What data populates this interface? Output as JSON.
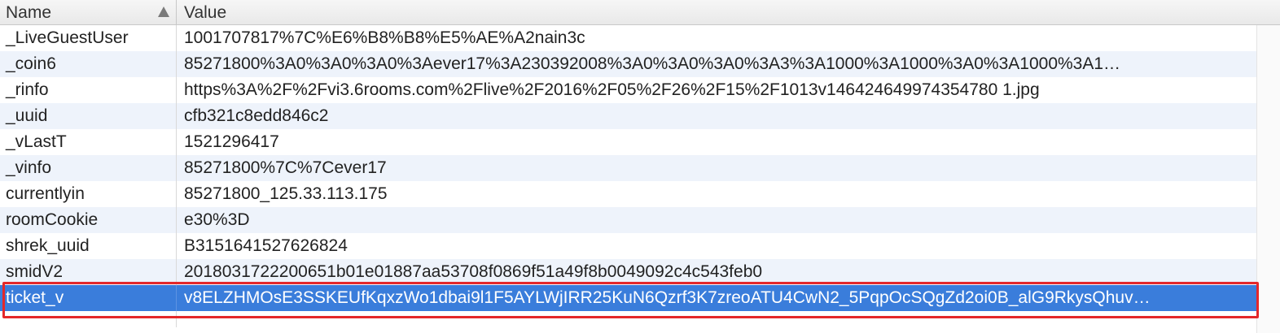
{
  "columns": {
    "name": "Name",
    "value": "Value"
  },
  "rows": [
    {
      "name": "_LiveGuestUser",
      "value": "1001707817%7C%E6%B8%B8%E5%AE%A2nain3c"
    },
    {
      "name": "_coin6",
      "value": "85271800%3A0%3A0%3A0%3Aever17%3A230392008%3A0%3A0%3A0%3A3%3A1000%3A1000%3A0%3A1000%3A1…"
    },
    {
      "name": "_rinfo",
      "value": "https%3A%2F%2Fvi3.6rooms.com%2Flive%2F2016%2F05%2F26%2F15%2F1013v146424649974354780 1.jpg"
    },
    {
      "name": "_uuid",
      "value": "cfb321c8edd846c2"
    },
    {
      "name": "_vLastT",
      "value": "1521296417"
    },
    {
      "name": "_vinfo",
      "value": "85271800%7C%7Cever17"
    },
    {
      "name": "currentlyin",
      "value": "85271800_125.33.113.175"
    },
    {
      "name": "roomCookie",
      "value": "e30%3D"
    },
    {
      "name": "shrek_uuid",
      "value": "B3151641527626824"
    },
    {
      "name": "smidV2",
      "value": "2018031722200651b01e01887aa53708f0869f51a49f8b0049092c4c543feb0"
    },
    {
      "name": "ticket_v",
      "value": "v8ELZHMOsE3SSKEUfKqxzWo1dbai9l1F5AYLWjIRR25KuN6Qzrf3K7zreoATU4CwN2_5PqpOcSQgZd2oi0B_alG9RkysQhuv…"
    }
  ],
  "selected_row": "ticket_v",
  "colors": {
    "selection": "#3a7ddb",
    "highlight_border": "#e4282a",
    "stripe": "#eef3fb"
  }
}
